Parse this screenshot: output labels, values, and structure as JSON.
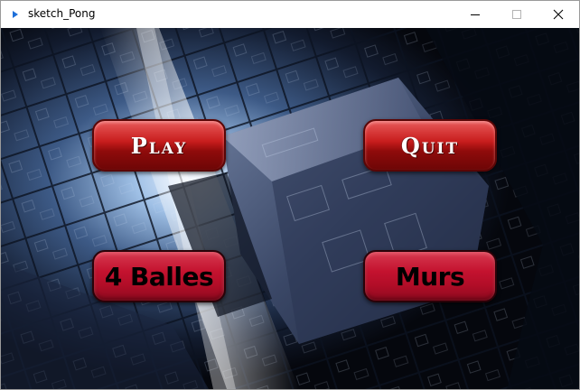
{
  "window": {
    "title": "sketch_Pong"
  },
  "menu": {
    "play_label": "Play",
    "quit_label": "Quit",
    "balls_label": "4 Balles",
    "walls_label": "Murs"
  },
  "colors": {
    "primary_button": "#c81d1d",
    "secondary_button": "#c4122f",
    "secondary_text": "#000000"
  }
}
